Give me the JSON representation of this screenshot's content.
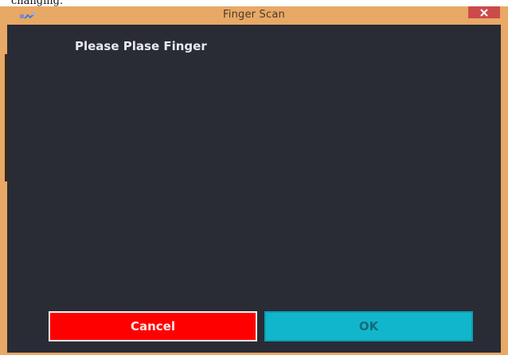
{
  "caption": "changing.",
  "window": {
    "title": "Finger Scan",
    "close_icon": "close-icon",
    "app_icon": "app-icon"
  },
  "main": {
    "prompt": "Please Plase Finger"
  },
  "buttons": {
    "cancel_label": "Cancel",
    "ok_label": "OK"
  },
  "colors": {
    "frame": "#e8a866",
    "client_bg": "#2a2c35",
    "cancel_bg": "#ff0000",
    "ok_bg": "#12b6cc",
    "close_bg": "#cc4a4a"
  }
}
